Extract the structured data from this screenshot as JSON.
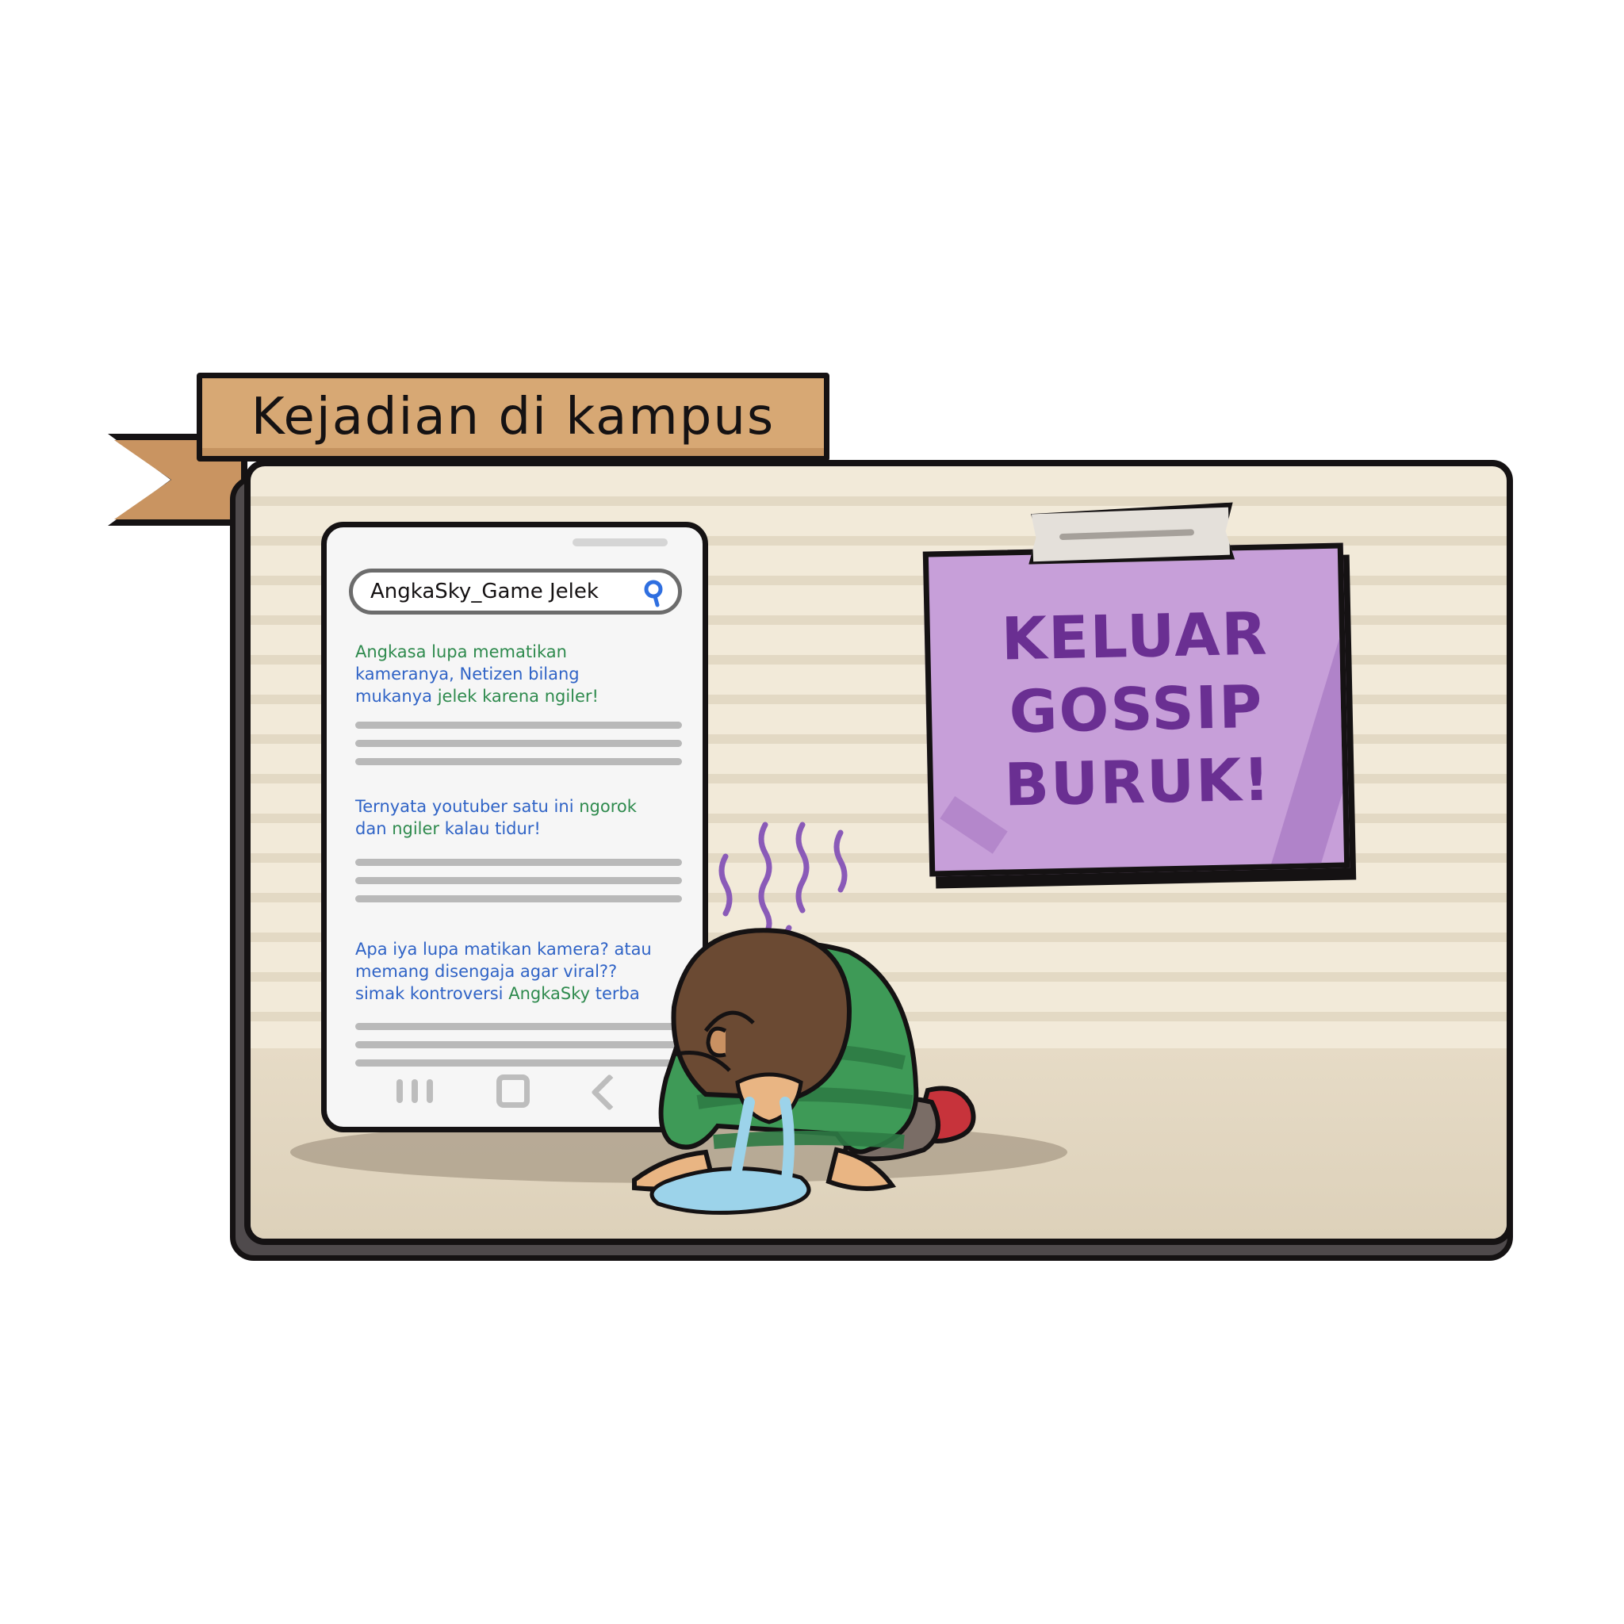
{
  "title_tag": "Kejadian di kampus",
  "phone": {
    "search_query": "AngkaSky_Game Jelek",
    "results": [
      {
        "line_1_a": "Angkasa",
        "line_1_b": " lupa mematikan",
        "line_2": "kameranya, Netizen bilang",
        "line_3_a": "mukanya",
        "line_3_b": " jelek karena ",
        "line_3_c": "ngiler!"
      },
      {
        "line_1_a": "Ternyata youtuber satu ini ",
        "line_1_b": "ngorok",
        "line_2_a": "dan ",
        "line_2_b": "ngiler",
        "line_2_c": " kalau tidur!"
      },
      {
        "line_1": "Apa iya lupa matikan kamera? atau",
        "line_2": "memang disengaja agar viral??",
        "line_3_a": "simak kontroversi ",
        "line_3_b": "AngkaSky",
        "line_3_c": " terba"
      }
    ]
  },
  "note": {
    "line_1": "KELUAR",
    "line_2": "GOSSIP",
    "line_3": "BURUK!"
  },
  "colors": {
    "panel_bg": "#f2ead9",
    "ribbon": "#d7a874",
    "note": "#c79fd9",
    "note_text": "#6a2f92",
    "link_blue": "#2f63c6",
    "link_green": "#2e8a4d"
  },
  "icons": [
    "search-icon",
    "recent-apps-icon",
    "home-icon",
    "back-icon"
  ]
}
